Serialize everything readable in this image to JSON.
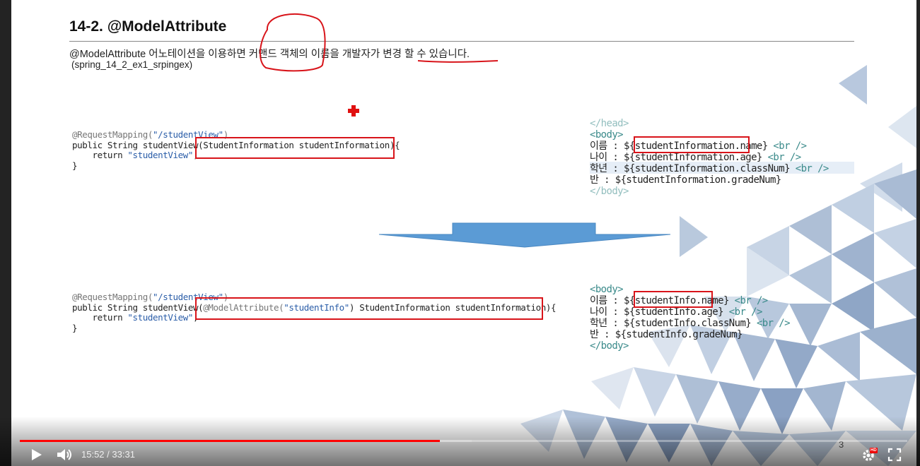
{
  "slide": {
    "title": "14-2. @ModelAttribute",
    "description": "@ModelAttribute 어노테이션을 이용하면 커맨드 객체의 이름을 개발자가 변경 할 수 있습니다.",
    "project": "(spring_14_2_ex1_srpingex)",
    "page_number": "3"
  },
  "code_before": {
    "line1_ann": "@RequestMapping(",
    "line1_str": "\"/studentView\"",
    "line1_end": ")",
    "line2_a": "public String studentView(",
    "line2_b": "StudentInformation studentInformation",
    "line2_c": "){",
    "line3_a": "    return ",
    "line3_str": "\"studentView\"",
    "line3_c": ";",
    "line4": "}"
  },
  "code_after": {
    "line1_ann": "@RequestMapping(",
    "line1_str": "\"/studentView\"",
    "line1_end": ")",
    "line2_a": "public String studentView(",
    "line2_ann": "@ModelAttribute(",
    "line2_str": "\"studentInfo\"",
    "line2_b": ") StudentInformation studentInformation",
    "line2_c": "){",
    "line3_a": "    return ",
    "line3_str": "\"studentView\"",
    "line3_c": ";",
    "line4": "}"
  },
  "jsp_before": {
    "head_close": "</head>",
    "body_open": "<body>",
    "rows": [
      {
        "label": "이름 : ${studentInformation.name} ",
        "tag": "<br />"
      },
      {
        "label": "나이 : ${studentInformation.age} ",
        "tag": "<br />"
      },
      {
        "label": "학년 : ${studentInformation.classNum} ",
        "tag": "<br />"
      },
      {
        "label": "반 : ${studentInformation.gradeNum}",
        "tag": ""
      }
    ],
    "body_close": "</body>"
  },
  "jsp_after": {
    "body_open": "<body>",
    "rows": [
      {
        "label": "이름 : ${studentInfo.name} ",
        "tag": "<br />"
      },
      {
        "label": "나이 : ${studentInfo.age} ",
        "tag": "<br />"
      },
      {
        "label": "학년 : ${studentInfo.classNum} ",
        "tag": "<br />"
      },
      {
        "label": "반 : ${studentInfo.gradeNum}",
        "tag": ""
      }
    ],
    "body_close": "</body>"
  },
  "player": {
    "current_time": "15:52",
    "separator": " / ",
    "duration": "33:31",
    "played_fraction": 0.4735,
    "hd_badge": "HD"
  },
  "colors": {
    "accent_red": "#d8141a",
    "arrow_blue": "#5b9bd5",
    "progress_red": "#ff0000"
  }
}
